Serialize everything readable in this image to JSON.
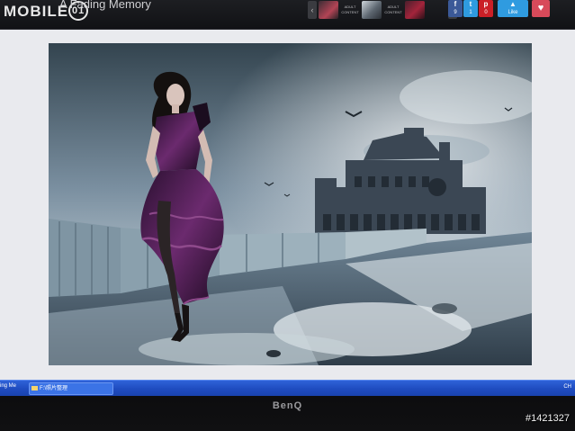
{
  "site": {
    "logo_text": "MOBILE",
    "logo_badge": "01",
    "page_title": "A Fading Memory"
  },
  "gallery_strip": {
    "prev_arrow": "‹",
    "next_arrow": "›",
    "adult_label_1": "ADULT CONTENT",
    "adult_label_2": "ADULT CONTENT"
  },
  "social": {
    "facebook": {
      "icon": "f",
      "count": "9"
    },
    "twitter": {
      "icon": "t",
      "count": "1"
    },
    "pinterest": {
      "icon": "p",
      "count": "0"
    },
    "like_label": "Like",
    "fav_icon": "♥"
  },
  "taskbar": {
    "left_text": "ing Me",
    "item_label": "F:\\照片整理",
    "tray_text": "CH"
  },
  "monitor": {
    "brand": "BenQ"
  },
  "watermark": {
    "post_id": "#1421327"
  },
  "colors": {
    "taskbar": "#1f4cc0",
    "facebook": "#3b5998",
    "twitter": "#2f9be0",
    "pinterest": "#cb2027",
    "favorite": "#d84a5a"
  }
}
